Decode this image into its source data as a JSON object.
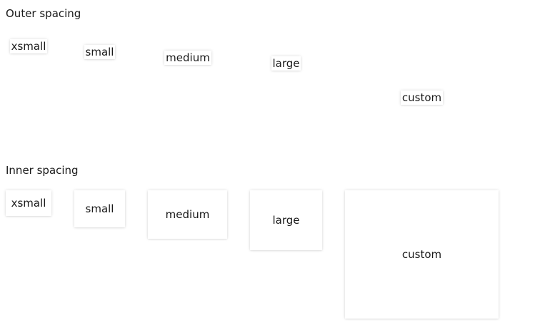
{
  "outer": {
    "title": "Outer spacing",
    "items": [
      {
        "label": "xsmall"
      },
      {
        "label": "small"
      },
      {
        "label": "medium"
      },
      {
        "label": "large"
      },
      {
        "label": "custom"
      }
    ]
  },
  "inner": {
    "title": "Inner spacing",
    "items": [
      {
        "label": "xsmall"
      },
      {
        "label": "small"
      },
      {
        "label": "medium"
      },
      {
        "label": "large"
      },
      {
        "label": "custom"
      }
    ]
  }
}
